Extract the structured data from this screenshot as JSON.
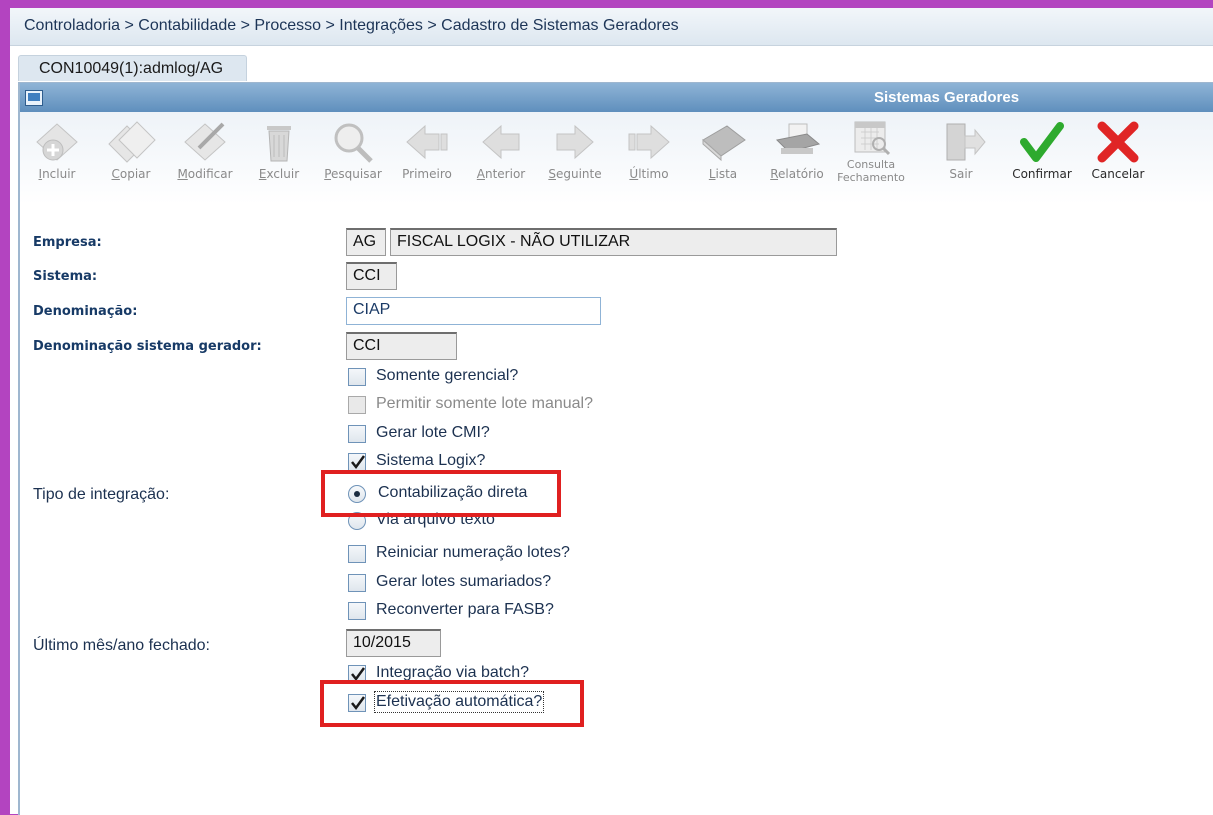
{
  "breadcrumb": "Controladoria > Contabilidade > Processo > Integrações > Cadastro de Sistemas Geradores",
  "tab": "CON10049(1):admlog/AG",
  "window": {
    "title": "Sistemas Geradores"
  },
  "toolbar": {
    "buttons": [
      {
        "label": "Incluir",
        "icon": "add-document-icon",
        "enabled": false
      },
      {
        "label": "Copiar",
        "icon": "copy-document-icon",
        "enabled": false
      },
      {
        "label": "Modificar",
        "icon": "edit-document-icon",
        "enabled": false
      },
      {
        "label": "Excluir",
        "icon": "trash-icon",
        "enabled": false
      },
      {
        "label": "Pesquisar",
        "icon": "magnifier-icon",
        "enabled": false
      },
      {
        "label": "Primeiro",
        "icon": "first-arrow-icon",
        "enabled": false
      },
      {
        "label": "Anterior",
        "icon": "previous-arrow-icon",
        "enabled": false
      },
      {
        "label": "Seguinte",
        "icon": "next-arrow-icon",
        "enabled": false
      },
      {
        "label": "Último",
        "icon": "last-arrow-icon",
        "enabled": false
      },
      {
        "label": "Lista",
        "icon": "book-icon",
        "enabled": false
      },
      {
        "label": "Relatório",
        "icon": "printer-icon",
        "enabled": false
      },
      {
        "label": "Consulta Fechamento",
        "label_line1": "Consulta",
        "label_line2": "Fechamento",
        "icon": "calendar-search-icon",
        "enabled": false
      },
      {
        "label": "Sair",
        "icon": "exit-door-icon",
        "enabled": false
      },
      {
        "label": "Confirmar",
        "icon": "checkmark-icon",
        "enabled": true
      },
      {
        "label": "Cancelar",
        "icon": "cancel-x-icon",
        "enabled": true
      }
    ]
  },
  "form": {
    "empresa": {
      "label": "Empresa:",
      "code": "AG",
      "name": "FISCAL LOGIX - NÃO UTILIZAR"
    },
    "sistema": {
      "label": "Sistema:",
      "value": "CCI"
    },
    "denominacao": {
      "label": "Denominação:",
      "value": "CIAP"
    },
    "denominacao_sistema": {
      "label": "Denominação sistema gerador:",
      "value": "CCI"
    },
    "checkboxes_a": [
      {
        "label": "Somente gerencial?",
        "checked": false,
        "disabled": false
      },
      {
        "label": "Permitir somente lote manual?",
        "checked": false,
        "disabled": true
      },
      {
        "label": "Gerar lote CMI?",
        "checked": false,
        "disabled": false
      },
      {
        "label": "Sistema Logix?",
        "checked": true,
        "disabled": false
      }
    ],
    "tipo_integracao": {
      "label": "Tipo de integração:",
      "options": [
        {
          "label": "Contabilização direta",
          "selected": true
        },
        {
          "label": "Via arquivo texto",
          "selected": false
        }
      ]
    },
    "checkboxes_b": [
      {
        "label": "Reiniciar numeração lotes?",
        "checked": false
      },
      {
        "label": "Gerar lotes sumariados?",
        "checked": false
      },
      {
        "label": "Reconverter para FASB?",
        "checked": false
      }
    ],
    "ultimo_mes": {
      "label": "Último mês/ano fechado:",
      "value": "10/2015"
    },
    "checkboxes_c": [
      {
        "label": "Integração via batch?",
        "checked": true
      },
      {
        "label": "Efetivação automática?",
        "checked": true
      }
    ]
  },
  "colors": {
    "highlight": "#e02020",
    "title_bar": "#5f8fbd",
    "label_text": "#173a66"
  }
}
